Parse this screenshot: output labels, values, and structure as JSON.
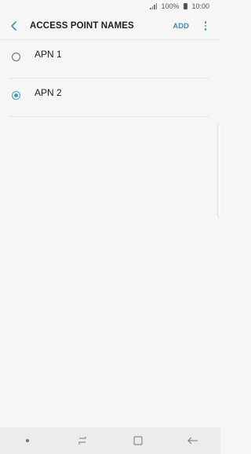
{
  "status_bar": {
    "battery_percent": "100%",
    "time": "10:00"
  },
  "toolbar": {
    "title": "ACCESS POINT NAMES",
    "add_label": "ADD"
  },
  "apn_list": [
    {
      "label": "APN 1",
      "selected": false
    },
    {
      "label": "APN 2",
      "selected": true
    }
  ],
  "colors": {
    "accent": "#3ba0c6",
    "background": "#f6f6f6",
    "nav_bar": "#ececec"
  },
  "icons": {
    "back": "chevron-left-icon",
    "more": "more-vertical-icon",
    "recents": "recent-apps-icon",
    "home": "home-icon",
    "nav_back": "back-arrow-icon"
  }
}
